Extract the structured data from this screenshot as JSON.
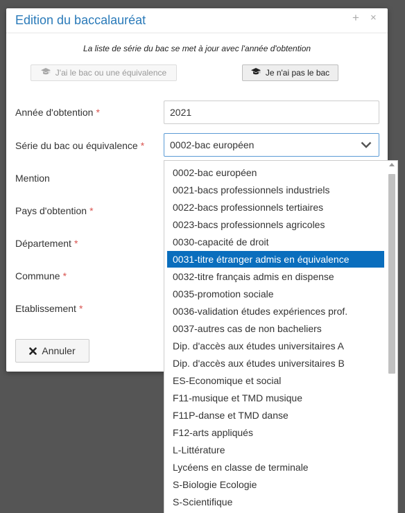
{
  "modal": {
    "title": "Edition du baccalauréat",
    "plus_icon": "+",
    "close_icon": "×",
    "info_text": "La liste de série du bac se met à jour avec l'année d'obtention",
    "btn_have_bac": "J'ai le bac ou une équivalence",
    "btn_no_bac": "Je n'ai pas le bac"
  },
  "form": {
    "annee": {
      "label": "Année d'obtention",
      "value": "2021"
    },
    "serie": {
      "label": "Série du bac ou équivalence",
      "value": "0002-bac européen"
    },
    "mention": {
      "label": "Mention"
    },
    "pays": {
      "label": "Pays d'obtention"
    },
    "departement": {
      "label": "Département"
    },
    "commune": {
      "label": "Commune"
    },
    "etablissement": {
      "label": "Etablissement"
    },
    "required_mark": "*"
  },
  "cancel_label": "Annuler",
  "dropdown": {
    "selected_index": 5,
    "options": [
      "0002-bac européen",
      "0021-bacs professionnels industriels",
      "0022-bacs professionnels tertiaires",
      "0023-bacs professionnels agricoles",
      "0030-capacité de droit",
      "0031-titre étranger admis en équivalence",
      "0032-titre français admis en dispense",
      "0035-promotion sociale",
      "0036-validation études expériences prof.",
      "0037-autres cas de non bacheliers",
      "Dip. d'accès aux études universitaires A",
      "Dip. d'accès aux études universitaires B",
      "ES-Economique et social",
      "F11-musique et TMD musique",
      "F11P-danse et TMD danse",
      "F12-arts appliqués",
      "L-Littérature",
      "Lycéens en classe de terminale",
      "S-Biologie Ecologie",
      "S-Scientifique"
    ]
  },
  "icons": {
    "graduation": "graduation-cap-icon",
    "chevron": "chevron-down-icon",
    "cancel": "x-icon"
  },
  "colors": {
    "title": "#2a7ab9",
    "required": "#d9534f",
    "selected_bg": "#0a6ebd",
    "focus_border": "#5b9bd5",
    "backdrop": "#555555"
  }
}
